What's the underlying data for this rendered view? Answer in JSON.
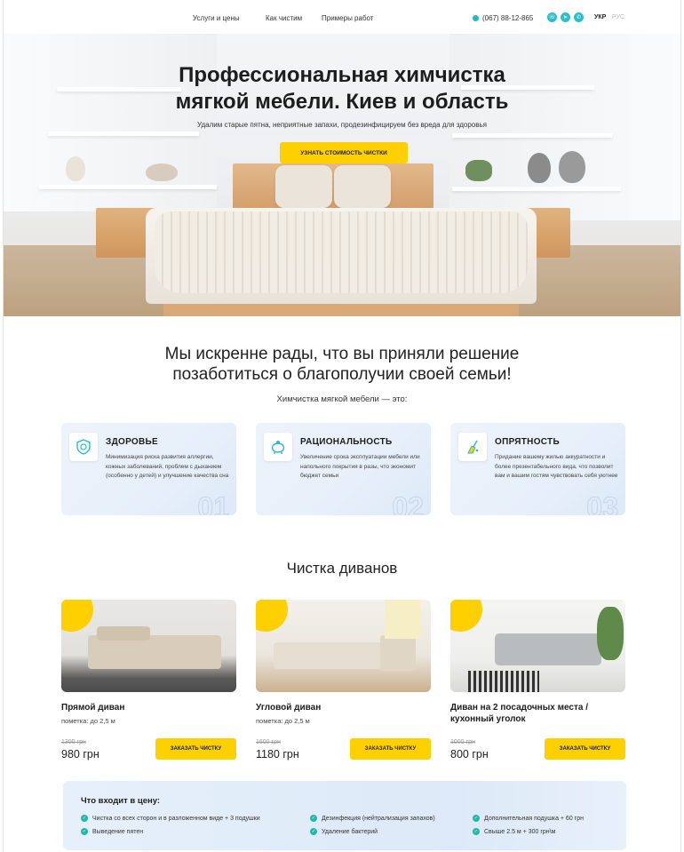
{
  "header": {
    "nav": [
      "Услуги и цены",
      "Как чистим",
      "Примеры работ"
    ],
    "phone": "(067) 88-12-865",
    "socials": [
      "viber-icon",
      "telegram-icon",
      "whatsapp-icon"
    ],
    "lang_active": "УКР",
    "lang_inactive": "РУС"
  },
  "hero": {
    "title_line1": "Профессиональная химчистка",
    "title_line2": "мягкой мебели. Киев и область",
    "subtitle": "Удалим старые пятна, неприятные запахи, продезинфицируем без вреда для здоровья",
    "cta": "Узнать стоимость чистки"
  },
  "intro": {
    "title_line1": "Мы искренне рады, что вы приняли решение",
    "title_line2": "позаботиться о благополучии своей семьи!",
    "subtitle": "Химчистка мягкой мебели — это:"
  },
  "features": [
    {
      "title": "ЗДОРОВЬЕ",
      "text": "Минимизация риска развития аллергии, кожных заболеваний, проблем с дыханием (особенно у детей) и улучшение качества сна",
      "num": "01",
      "icon": "health-shield-icon"
    },
    {
      "title": "РАЦИОНАЛЬНОСТЬ",
      "text": "Увеличение срока эксплуатации мебели или напольного покрытия в разы, что экономит бюджет семьи",
      "num": "02",
      "icon": "piggy-bank-icon"
    },
    {
      "title": "ОПРЯТНОСТЬ",
      "text": "Придание вашему жилью аккуратности и более презентабельного вида, что позволит вам и вашим гостям чувствовать себя уютнее",
      "num": "03",
      "icon": "cleaning-icon"
    }
  ],
  "sofas": {
    "heading": "Чистка диванов",
    "button": "Заказать чистку",
    "items": [
      {
        "title": "Прямой диван",
        "note": "пометка: до 2,5 м",
        "old_price": "1300 грн",
        "price": "980 грн"
      },
      {
        "title": "Угловой диван",
        "note": "пометка: до 2,5 м",
        "old_price": "1600 грн",
        "price": "1180 грн"
      },
      {
        "title": "Диван на 2 посадочных места / кухонный уголок",
        "note": "",
        "old_price": "1000 грн",
        "price": "800 грн"
      }
    ]
  },
  "included": {
    "title": "Что входит в цену:",
    "items": [
      "Чистка со всех сторон и в разложенном виде + 3 подушки",
      "Выведение пятен",
      "Дезинфекция (нейтрализация запахов)",
      "Удаление бактерий",
      "Дополнительная подушка + 60 грн",
      "Свыше 2.5 м + 300 грн\\м"
    ]
  },
  "colors": {
    "accent": "#ffd000",
    "teal": "#22b8a8",
    "card_bg": "#e7effa"
  }
}
